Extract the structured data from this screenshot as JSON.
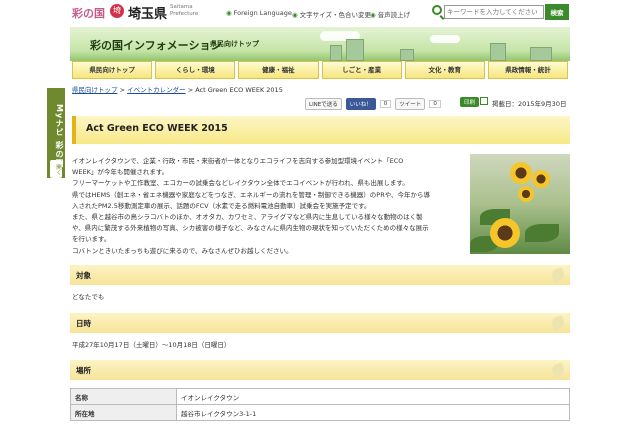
{
  "header": {
    "logo_mark": "彩の国",
    "logo_seal": "埼",
    "logo_ken": "埼玉県",
    "logo_en_1": "Saitama",
    "logo_en_2": "Prefecture",
    "links": [
      "Foreign Language",
      "文字サイズ・色合い変更",
      "音声読上げ"
    ],
    "search_placeholder": "キーワードを入力してください",
    "search_button": "検索"
  },
  "banner": {
    "title": "彩の国インフォメーション",
    "subtitle": "県民向けトップ"
  },
  "nav": [
    "県民向けトップ",
    "くらし・環境",
    "健康・福祉",
    "しごと・産業",
    "文化・教育",
    "県政情報・統計"
  ],
  "side_tab": {
    "label": "Myナビ 彩の国",
    "open": "開く"
  },
  "breadcrumb": [
    "県民向けトップ",
    "イベントカレンダー",
    "Act Green ECO WEEK 2015"
  ],
  "breadcrumb_sep": ">",
  "share": {
    "line": "LINEで送る",
    "facebook": "いいね！",
    "facebook_count": "0",
    "tweet": "ツイート",
    "tweet_count": "0",
    "print": "印刷",
    "post_date": "掲載日：2015年9月30日"
  },
  "page_title": "Act Green ECO WEEK 2015",
  "body_lines": [
    "イオンレイクタウンで、企業・行政・市民・来街者が一体となりエコライフを志向する参加型環境イベント「ECO",
    "WEEK」が今年も開催されます。",
    "フリーマーケットや工作教室、エコカーの試乗会などレイクタウン全体でエコイベントが行われ、県も出展します。",
    "県ではHEMS（創エネ・省エネ機器や家庭などをつなぎ、エネルギーの流れを管理・制御できる機器）のPRや、今年から導",
    "入されたPM2.5移動測定車の展示、話題のFCV（水素で走る燃料電池自動車）試乗会を実施予定です。",
    "また、県と越谷市の鳥シラコバトのほか、オオタカ、カワセミ、アライグマなど県内に生息している様々な動物のはく製",
    "や、県内に繁茂する外来植物の写真、シカ被害の様子など、みなさんに県内生物の現状を知っていただくための様々な展示",
    "を行います。",
    "コバトンときいたまっちも遊びに来るので、みなさんぜひお越しください。"
  ],
  "sections": {
    "target_label": "対象",
    "target_value": "どなたでも",
    "date_label": "日時",
    "date_value": "平成27年10月17日（土曜日）～10月18日（日曜日）",
    "place_label": "場所"
  },
  "place_table": [
    {
      "key": "名称",
      "value": "イオンレイクタウン"
    },
    {
      "key": "所在地",
      "value": "越谷市レイクタウン3-1-1"
    }
  ],
  "colors": {
    "accent_green": "#3a8a2a",
    "nav_yellow": "#f6e680",
    "section_yellow": "#f6e49a",
    "link_blue": "#1a4ea0"
  }
}
